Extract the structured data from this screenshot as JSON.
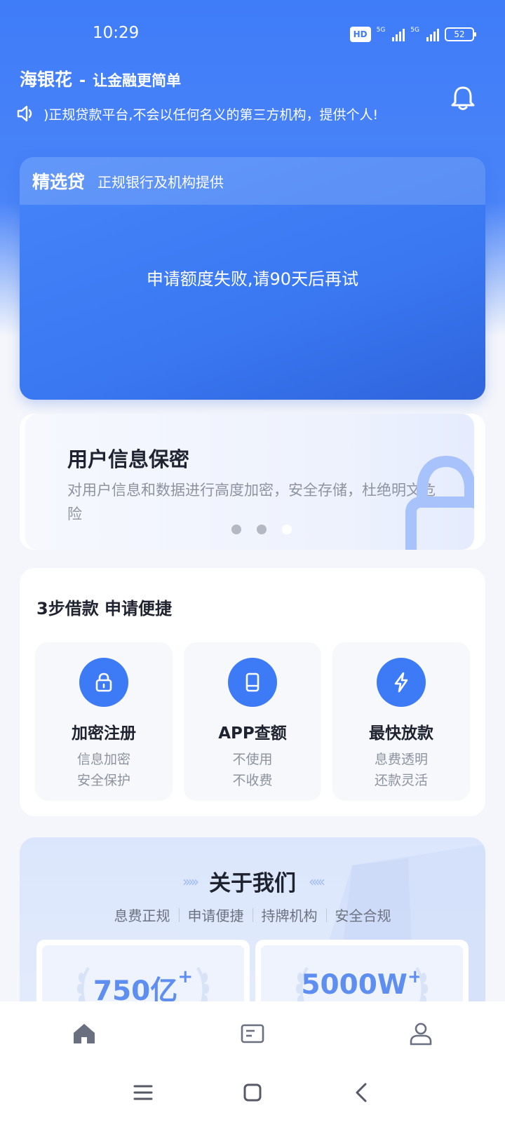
{
  "status": {
    "time": "10:29",
    "hd": "HD",
    "net1": "5G",
    "net2": "5G",
    "battery": "52"
  },
  "header": {
    "brand": "海银花",
    "dash": "-",
    "slogan": "让金融更简单",
    "notice": ")正规贷款平台,不会以任何名义的第三方机构，提供个人!"
  },
  "loan_card": {
    "title": "精选贷",
    "subtitle": "正规银行及机构提供",
    "message": "申请额度失败,请90天后再试"
  },
  "promo": {
    "title": "用户信息保密",
    "description": "对用户信息和数据进行高度加密，安全存储，杜绝明文危险"
  },
  "steps": {
    "title": "3步借款 申请便捷",
    "items": [
      {
        "title": "加密注册",
        "line1": "信息加密",
        "line2": "安全保护",
        "icon": "lock-icon"
      },
      {
        "title": "APP查额",
        "line1": "不使用",
        "line2": "不收费",
        "icon": "tablet-icon"
      },
      {
        "title": "最快放款",
        "line1": "息费透明",
        "line2": "还款灵活",
        "icon": "lightning-icon"
      }
    ]
  },
  "about": {
    "title": "关于我们",
    "tags": [
      "息费正规",
      "申请便捷",
      "持牌机构",
      "安全合规"
    ],
    "stats": [
      {
        "value": "750亿",
        "suffix": "+"
      },
      {
        "value": "5000W",
        "suffix": "+"
      }
    ]
  },
  "colors": {
    "primary": "#3d7bf6",
    "stat": "#5d8ef0"
  }
}
